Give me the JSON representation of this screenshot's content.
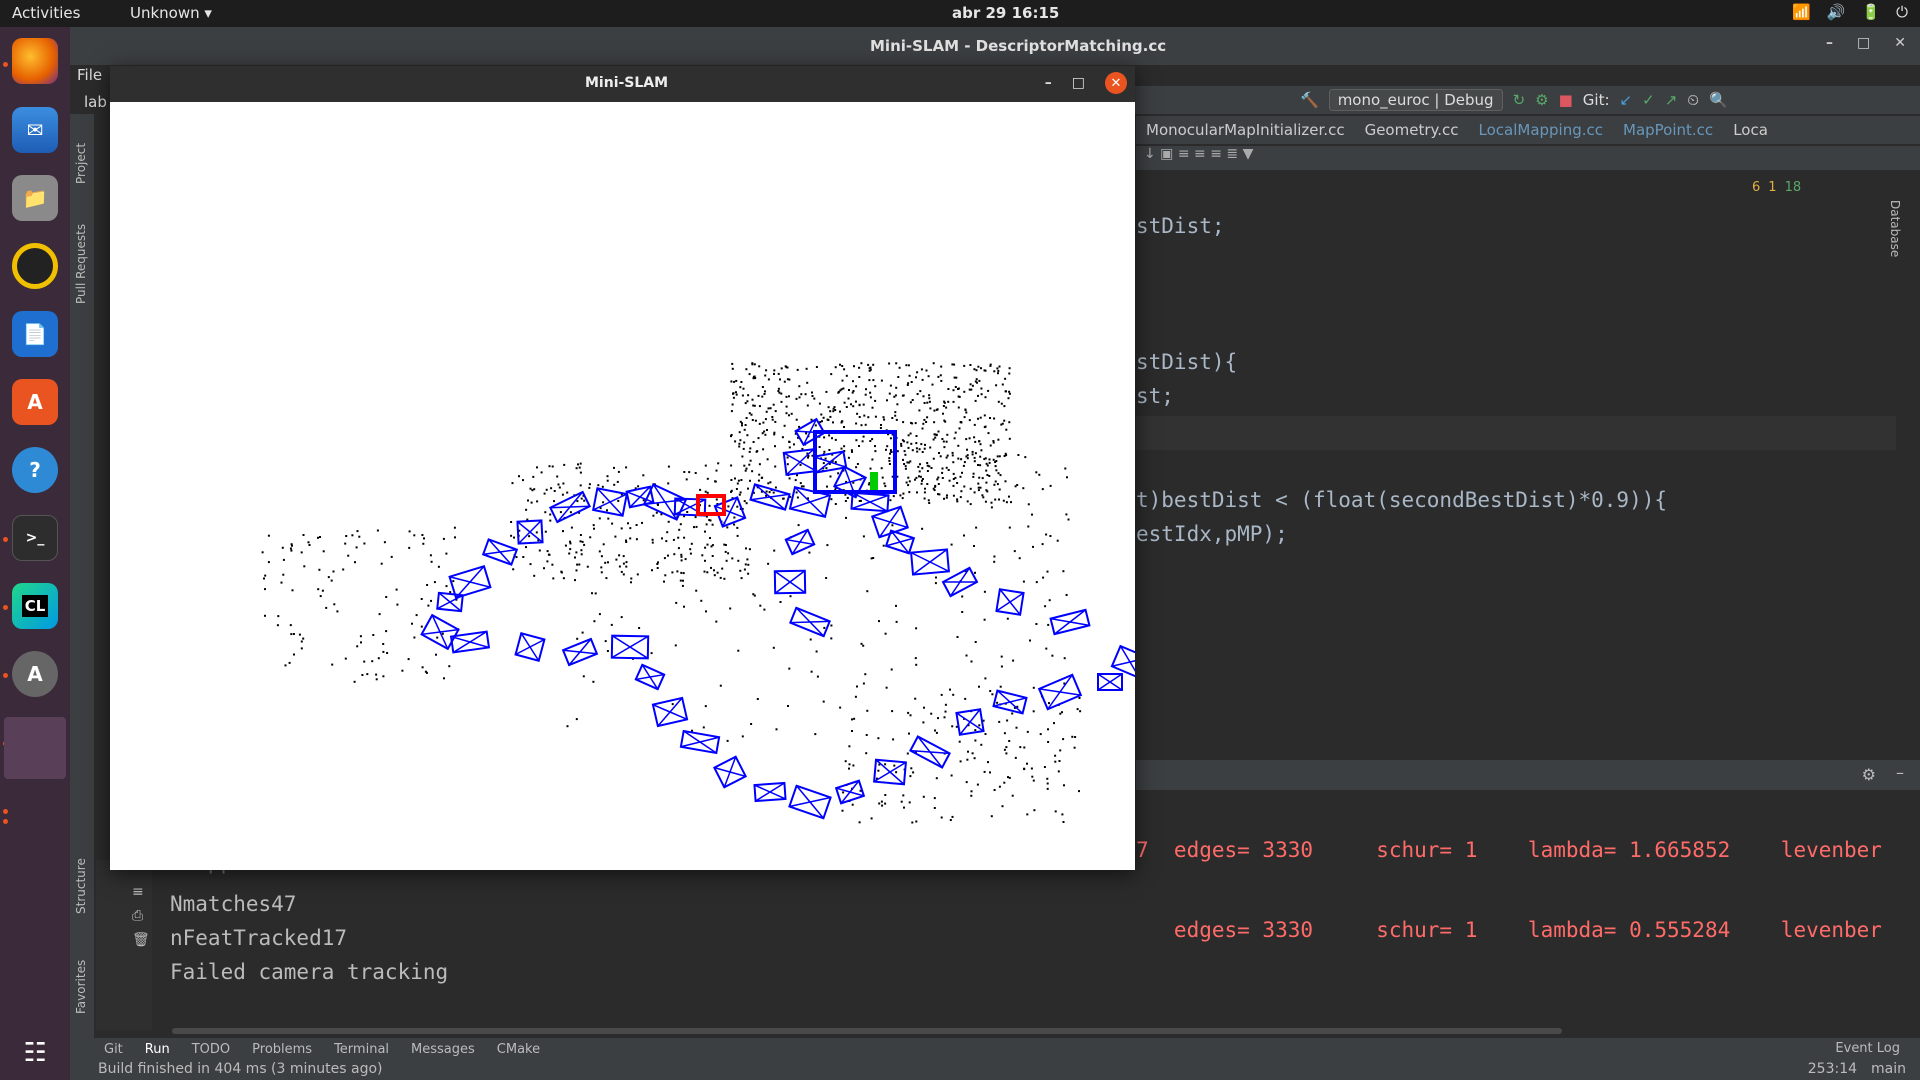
{
  "topbar": {
    "activities": "Activities",
    "app_menu": "Unknown ▾",
    "clock": "abr 29  16:15",
    "tray": [
      "wifi-icon",
      "volume-icon",
      "battery-icon",
      "power-icon"
    ]
  },
  "dock": {
    "items": [
      "firefox",
      "thunderbird",
      "files",
      "rhythmbox",
      "libreoffice-writer",
      "software",
      "help",
      "terminal",
      "clion",
      "software-updater",
      "workspace"
    ],
    "apps_button": "show-applications-icon"
  },
  "ide": {
    "window_title": "Mini-SLAM - DescriptorMatching.cc",
    "menu_file": "File",
    "menu_lab": "lab",
    "run_config": "mono_euroc | Debug",
    "git_label": "Git:",
    "tabs": [
      "MonocularMapInitializer.cc",
      "Geometry.cc",
      "LocalMapping.cc",
      "MapPoint.cc",
      "Loca"
    ],
    "inspections": {
      "warnings": "6",
      "weak": "1",
      "ok": "18"
    },
    "code": [
      "stDist;",
      "",
      "",
      "stDist){",
      "st;",
      "",
      "t)bestDist < (float(secondBestDist)*0.9)){",
      "estIdx,pMP);"
    ],
    "run_output": [
      "7  edges= 3330     schur= 1    lambda= 1.665852    levenber",
      "   edges= 3330     schur= 1    lambda= 0.555284    levenber"
    ],
    "console": [
      "Nmappoints84",
      "Nmatches47",
      "nFeatTracked17",
      "Failed camera tracking"
    ],
    "left_labels": [
      "Project",
      "Pull Requests",
      "Structure",
      "Favorites"
    ],
    "right_label": "Database",
    "bottom_tabs": [
      "Git",
      "Run",
      "TODO",
      "Problems",
      "Terminal",
      "Messages",
      "CMake"
    ],
    "event_log": "Event Log",
    "status_message": "Build finished in 404 ms (3 minutes ago)",
    "status_position": "253:14",
    "status_branch": "main"
  },
  "slam_window": {
    "title": "Mini-SLAM",
    "colors": {
      "keyframes": "#0000ff",
      "current_camera": "#ff0000",
      "map_points": "#000000",
      "green_marker": "#00cc00"
    }
  }
}
